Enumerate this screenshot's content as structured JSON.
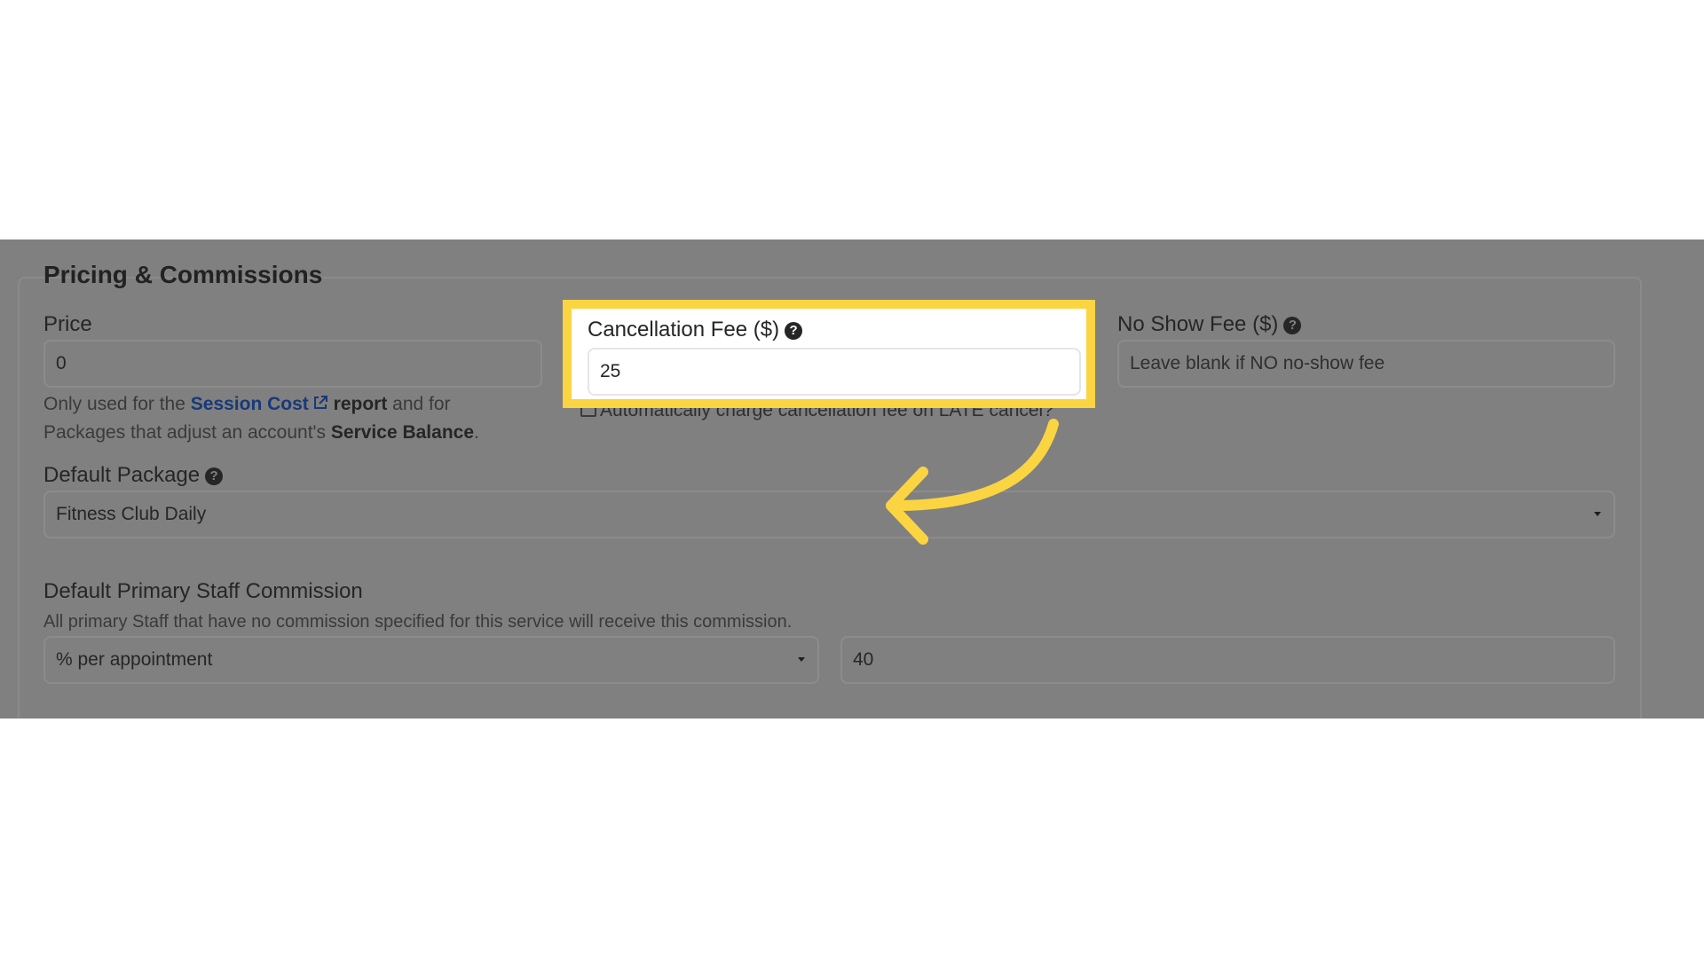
{
  "section": {
    "title": "Pricing & Commissions"
  },
  "price": {
    "label": "Price",
    "value": "0",
    "help_prefix": "Only used for the ",
    "help_link": "Session Cost",
    "help_mid1": " report",
    "help_mid2": " and for",
    "help_line2_prefix": "Packages that adjust an account's ",
    "help_bold": "Service Balance",
    "help_suffix": "."
  },
  "cancellation_fee": {
    "label": "Cancellation Fee ($)",
    "value": "25",
    "checkbox_label": "Automatically charge cancellation fee on LATE cancel?"
  },
  "no_show_fee": {
    "label": "No Show Fee ($)",
    "placeholder": "Leave blank if NO no-show fee"
  },
  "default_package": {
    "label": "Default Package",
    "selected": "Fitness Club Daily"
  },
  "commission": {
    "label": "Default Primary Staff Commission",
    "description": "All primary Staff that have no commission specified for this service will receive this commission.",
    "type_selected": "% per appointment",
    "amount": "40"
  },
  "colors": {
    "highlight": "#fbd442",
    "overlay": "#808080",
    "link": "#18397a"
  },
  "icons": {
    "help": "question-circle-icon",
    "external_link": "external-link-icon",
    "annotation": "curved-arrow-icon"
  }
}
